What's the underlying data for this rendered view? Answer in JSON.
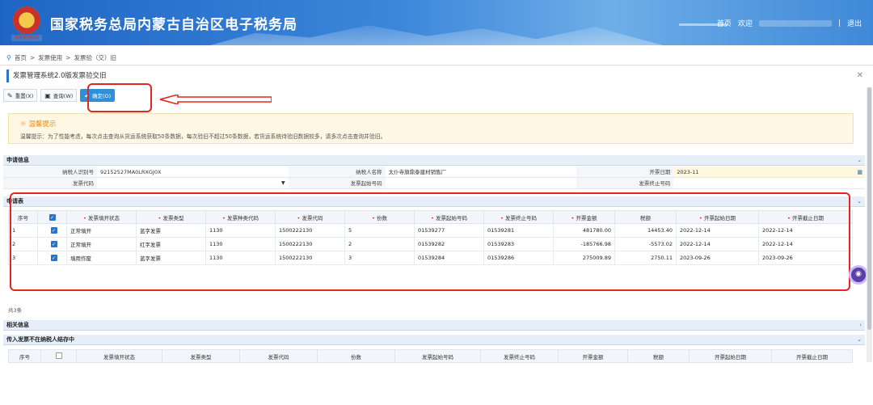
{
  "header": {
    "emblem_text": "国家税务总局",
    "site_title": "国家税务总局内蒙古自治区电子税务局",
    "home_label": "首页",
    "welcome_label": "欢迎",
    "logout_label": "退出",
    "divider": "|"
  },
  "breadcrumb": [
    "首页",
    ">",
    "发票使用",
    ">",
    "发票验（交）旧"
  ],
  "panel_title": "发票管理系统2.0版发票验交旧",
  "toolbar": {
    "reset_label": "重置(X)",
    "query_label": "查询(W)",
    "confirm_label": "确定(O)"
  },
  "notice": {
    "title": "温馨提示",
    "body": "温馨提示：为了性能考虑，每次点击查询从货运系统获取50条数据，每次验旧不超过50条数据，若货运系统待验旧数据较多，请多次点击查询并验旧。"
  },
  "apply_info": {
    "section_label": "申请信息",
    "taxpayer_id_label": "纳税人识别号",
    "taxpayer_id": "92152527MA0LRXGJ0X",
    "taxpayer_name_label": "纳税人名称",
    "taxpayer_name": "太仆寺旗鼎泰建材销售厂",
    "issue_date_label": "开票日期",
    "issue_date": "2023-11",
    "invoice_code_label": "发票代码",
    "invoice_code": "",
    "start_no_label": "发票起始号码",
    "start_no": "",
    "end_no_label": "发票终止号码",
    "end_no": ""
  },
  "apply_table": {
    "section_label": "申请表",
    "headers": [
      "序号",
      "",
      "发票填开状态",
      "发票类型",
      "发票种类代码",
      "发票代码",
      "份数",
      "发票起始号码",
      "发票终止号码",
      "开票金额",
      "税额",
      "开票起始日期",
      "开票截止日期"
    ],
    "required": [
      false,
      false,
      true,
      true,
      true,
      true,
      true,
      true,
      true,
      true,
      false,
      true,
      true
    ],
    "rows": [
      [
        "1",
        "✓",
        "正常填开",
        "蓝字发票",
        "1130",
        "1500222130",
        "5",
        "01539277",
        "01539281",
        "481780.00",
        "14453.40",
        "2022-12-14",
        "2022-12-14"
      ],
      [
        "2",
        "✓",
        "正常填开",
        "红字发票",
        "1130",
        "1500222130",
        "2",
        "01539282",
        "01539283",
        "-185766.98",
        "-5573.02",
        "2022-12-14",
        "2022-12-14"
      ],
      [
        "3",
        "✓",
        "填用作废",
        "蓝字发票",
        "1130",
        "1500222130",
        "3",
        "01539284",
        "01539286",
        "275009.89",
        "2750.11",
        "2023-09-26",
        "2023-09-26"
      ]
    ],
    "total_label": "共3条"
  },
  "related_info": {
    "section_label": "相关信息"
  },
  "missing_table": {
    "section_label": "传入发票不在纳税人结存中",
    "headers": [
      "序号",
      "",
      "发票填开状态",
      "发票类型",
      "发票代码",
      "份数",
      "发票起始号码",
      "发票终止号码",
      "开票金额",
      "税额",
      "开票起始日期",
      "开票截止日期"
    ]
  },
  "colors": {
    "accent": "#2a73c9",
    "annotation": "#e0281f",
    "notice_bg": "#fdf7e3"
  }
}
